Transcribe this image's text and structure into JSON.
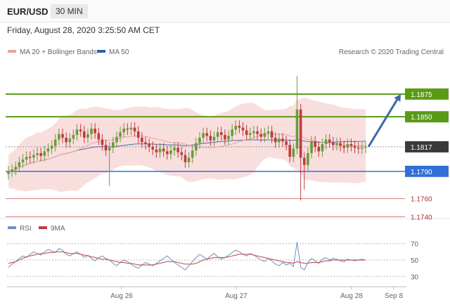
{
  "header": {
    "pair": "EUR/USD",
    "timeframe": "30 MIN",
    "datetime": "Friday, August 28, 2020 3:25:50 AM CET"
  },
  "legend": {
    "ma20": "MA 20 + Bollinger Bands",
    "ma50": "MA 50",
    "copyright": "Research © 2020 Trading Central"
  },
  "rsi_legend": {
    "rsi": "RSI",
    "ma9": "9MA"
  },
  "colors": {
    "up_level": "#5a9b16",
    "current": "#3a3a3a",
    "support": "#2f6fd6",
    "down_level": "#d57b7b",
    "candle_up": "#6a9b3a",
    "candle_down": "#c03b3b",
    "bollinger": "#f7d3d3",
    "ma50": "#4b6ea8",
    "ma20": "#e8a3a3",
    "arrow": "#3d6aa8",
    "rsi": "#6f8fbf",
    "rsi_ma": "#c46060"
  },
  "chart_data": [
    {
      "type": "candlestick",
      "title": "EUR/USD",
      "ylim": [
        1.1735,
        1.1905
      ],
      "x_labels": [
        "Aug 26",
        "Aug 27",
        "Aug 28",
        "Sep 8"
      ],
      "levels": [
        {
          "value": 1.1875,
          "label": "1.1875",
          "kind": "resistance"
        },
        {
          "value": 1.185,
          "label": "1.1850",
          "kind": "resistance"
        },
        {
          "value": 1.1817,
          "label": "1.1817",
          "kind": "current"
        },
        {
          "value": 1.179,
          "label": "1.1790",
          "kind": "support"
        },
        {
          "value": 1.176,
          "label": "1.1760",
          "kind": "support"
        },
        {
          "value": 1.174,
          "label": "1.1740",
          "kind": "support"
        }
      ],
      "close": [
        1.179,
        1.1792,
        1.1795,
        1.18,
        1.1803,
        1.1806,
        1.1805,
        1.1808,
        1.181,
        1.1807,
        1.1812,
        1.1815,
        1.1818,
        1.1825,
        1.1831,
        1.1827,
        1.1822,
        1.1826,
        1.183,
        1.1836,
        1.1834,
        1.1827,
        1.1831,
        1.1837,
        1.1832,
        1.1825,
        1.1819,
        1.1813,
        1.1816,
        1.1822,
        1.1828,
        1.1833,
        1.1837,
        1.1836,
        1.1838,
        1.1834,
        1.1827,
        1.1822,
        1.182,
        1.1817,
        1.1814,
        1.1811,
        1.1815,
        1.1812,
        1.1809,
        1.1813,
        1.1816,
        1.1811,
        1.1808,
        1.18,
        1.1805,
        1.1813,
        1.1821,
        1.1827,
        1.1832,
        1.1829,
        1.1824,
        1.1828,
        1.1833,
        1.183,
        1.1825,
        1.1829,
        1.1836,
        1.184,
        1.1838,
        1.1835,
        1.183,
        1.1832,
        1.1834,
        1.1831,
        1.1828,
        1.1832,
        1.1834,
        1.1827,
        1.1822,
        1.1826,
        1.1823,
        1.1819,
        1.1806,
        1.1815,
        1.1858,
        1.1805,
        1.1797,
        1.181,
        1.1823,
        1.1817,
        1.1812,
        1.182,
        1.1825,
        1.1822,
        1.1819,
        1.1821,
        1.1818,
        1.1816,
        1.182,
        1.1818,
        1.1816,
        1.1815,
        1.1816,
        1.1817
      ],
      "rsi": [
        41,
        45,
        48,
        52,
        55,
        53,
        57,
        60,
        58,
        56,
        60,
        63,
        61,
        59,
        64,
        62,
        57,
        55,
        58,
        60,
        57,
        53,
        56,
        52,
        49,
        53,
        55,
        52,
        50,
        46,
        43,
        47,
        50,
        48,
        45,
        42,
        40,
        44,
        47,
        45,
        43,
        46,
        49,
        52,
        55,
        51,
        47,
        44,
        41,
        38,
        43,
        48,
        53,
        57,
        54,
        51,
        55,
        58,
        54,
        51,
        53,
        56,
        59,
        62,
        60,
        57,
        55,
        58,
        56,
        53,
        50,
        48,
        52,
        49,
        45,
        43,
        47,
        44,
        46,
        42,
        72,
        41,
        38,
        47,
        52,
        49,
        46,
        51,
        53,
        50,
        52,
        51,
        49,
        48,
        51,
        50,
        49,
        50,
        51,
        50
      ],
      "rsi_ma": [
        46,
        47,
        48,
        50,
        52,
        54,
        55,
        56,
        57,
        58,
        58,
        59,
        59,
        60,
        60,
        60,
        59,
        58,
        58,
        58,
        57,
        56,
        55,
        54,
        53,
        52,
        51,
        51,
        50,
        49,
        48,
        47,
        47,
        46,
        46,
        45,
        44,
        44,
        44,
        44,
        44,
        45,
        46,
        47,
        48,
        48,
        48,
        47,
        46,
        45,
        45,
        45,
        46,
        48,
        50,
        51,
        52,
        53,
        53,
        53,
        53,
        54,
        55,
        56,
        57,
        57,
        57,
        57,
        56,
        55,
        54,
        53,
        52,
        51,
        50,
        49,
        48,
        47,
        47,
        46,
        48,
        47,
        46,
        46,
        47,
        47,
        47,
        48,
        49,
        49,
        50,
        50,
        50,
        50,
        50,
        50,
        50,
        50,
        50,
        50
      ],
      "rsi_ticks": [
        70,
        50,
        30
      ]
    }
  ]
}
